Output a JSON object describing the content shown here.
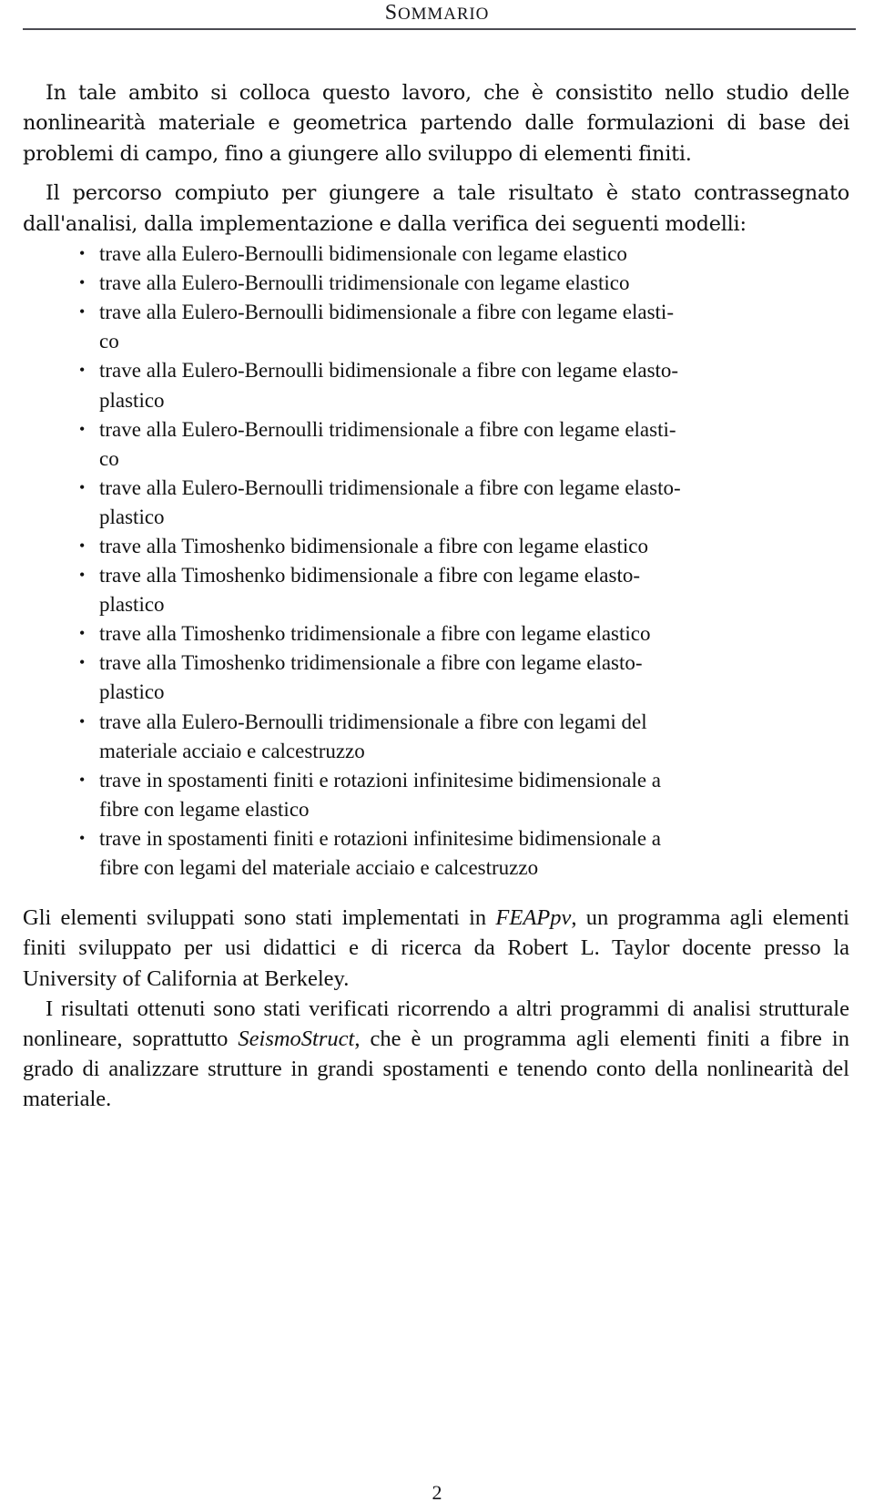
{
  "header": {
    "title": "SOMMARIO",
    "title_initial": "S",
    "title_rest": "OMMARIO"
  },
  "body": {
    "paragraph_1": "In tale ambito si colloca questo lavoro, che è consistito nello studio delle nonlinearità materiale e geometrica partendo dalle formulazioni di base dei problemi di campo, fino a giungere allo sviluppo di elementi finiti.",
    "paragraph_2": "Il percorso compiuto per giungere a tale risultato è stato contrassegnato dall'analisi, dalla implementazione e dalla verifica dei seguenti modelli:",
    "list": [
      {
        "text": "trave alla Eulero-Bernoulli bidimensionale con legame elastico",
        "tail": ""
      },
      {
        "text": "trave alla Eulero-Bernoulli tridimensionale con legame elastico",
        "tail": ""
      },
      {
        "text": "trave alla Eulero-Bernoulli bidimensionale a fibre con legame elasti-",
        "tail": "co"
      },
      {
        "text": "trave alla Eulero-Bernoulli bidimensionale a fibre con legame elasto-",
        "tail": "plastico"
      },
      {
        "text": "trave alla Eulero-Bernoulli tridimensionale a fibre con legame elasti-",
        "tail": "co"
      },
      {
        "text": "trave alla Eulero-Bernoulli tridimensionale a fibre con legame elasto-",
        "tail": "plastico"
      },
      {
        "text": "trave alla Timoshenko bidimensionale a fibre con legame elastico",
        "tail": ""
      },
      {
        "text": "trave alla Timoshenko bidimensionale a fibre con legame elasto-",
        "tail": "plastico"
      },
      {
        "text": "trave alla Timoshenko tridimensionale a fibre con legame elastico",
        "tail": ""
      },
      {
        "text": "trave alla Timoshenko tridimensionale a fibre con legame elasto-",
        "tail": "plastico"
      },
      {
        "text": "trave alla Eulero-Bernoulli tridimensionale a fibre con legami del",
        "tail": "materiale acciaio e calcestruzzo"
      },
      {
        "text": "trave in spostamenti finiti e rotazioni infinitesime bidimensionale a",
        "tail": "fibre con legame elastico"
      },
      {
        "text": "trave in spostamenti finiti e rotazioni infinitesime bidimensionale a",
        "tail": "fibre con legami del materiale acciaio e calcestruzzo"
      }
    ],
    "paragraph_3_part_1": "Gli elementi sviluppati sono stati implementati in ",
    "paragraph_3_italic": "FEAPpv",
    "paragraph_3_part_2": ", un programma agli elementi finiti sviluppato per usi didattici e di ricerca da Robert L. Taylor docente presso la University of California at Berkeley.",
    "paragraph_4_part_1": "I risultati ottenuti sono stati verificati ricorrendo a altri programmi di analisi strutturale nonlineare, soprattutto ",
    "paragraph_4_italic": "SeismoStruct",
    "paragraph_4_part_2": ", che è un programma agli elementi finiti a fibre in grado di analizzare strutture in grandi spostamenti e tenendo conto della nonlinearità del materiale."
  },
  "footer": {
    "page_number": "2"
  }
}
